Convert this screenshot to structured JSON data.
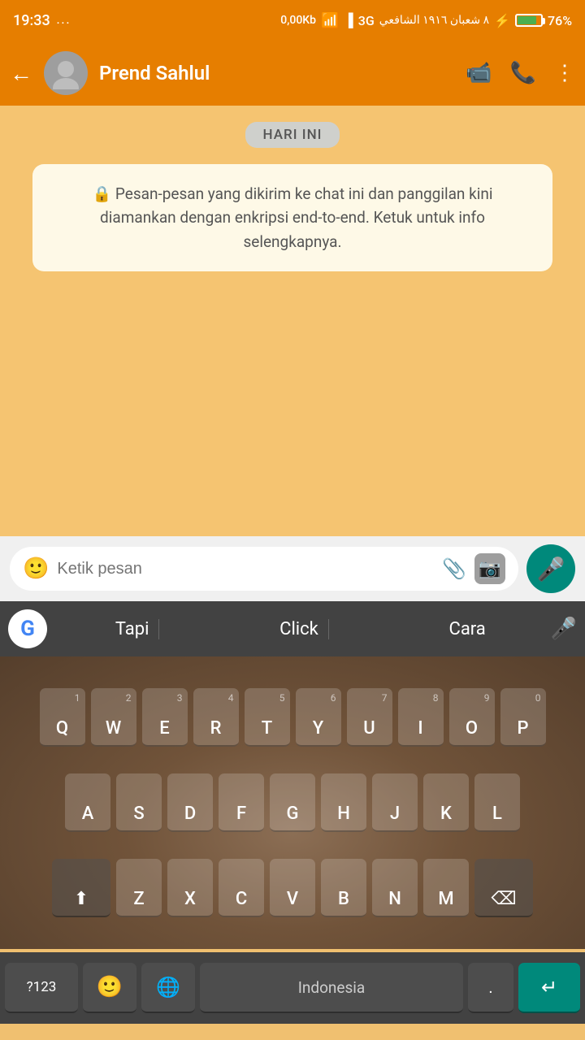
{
  "status_bar": {
    "time": "19:33",
    "dots": "...",
    "network_speed": "0,00Kb",
    "network_type": "3G",
    "arabic_date": "٨ شعبان ١٩١٦ الشافعي",
    "battery_percent": "76%"
  },
  "header": {
    "contact_name": "Prend Sahlul",
    "back_label": "←"
  },
  "chat": {
    "date_badge": "HARI INI",
    "encryption_notice": "🔒 Pesan-pesan yang dikirim ke chat ini dan panggilan kini diamankan dengan enkripsi end-to-end. Ketuk untuk info selengkapnya."
  },
  "input_bar": {
    "placeholder": "Ketik pesan"
  },
  "suggestions": {
    "word1": "Tapi",
    "word2": "Click",
    "word3": "Cara"
  },
  "keyboard": {
    "rows": [
      [
        "Q",
        "W",
        "E",
        "R",
        "T",
        "Y",
        "U",
        "I",
        "O",
        "P"
      ],
      [
        "A",
        "S",
        "D",
        "F",
        "G",
        "H",
        "J",
        "K",
        "L"
      ],
      [
        "Z",
        "X",
        "C",
        "V",
        "B",
        "N",
        "M"
      ]
    ],
    "numbers": [
      "1",
      "2",
      "3",
      "4",
      "5",
      "6",
      "7",
      "8",
      "9",
      "0"
    ],
    "bottom": {
      "num_label": "?123",
      "space_label": "Indonesia",
      "dot_label": "."
    }
  }
}
